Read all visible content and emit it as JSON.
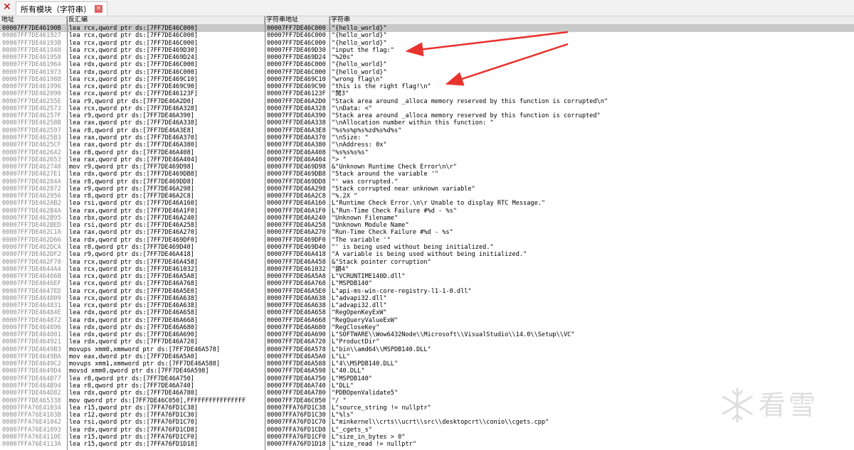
{
  "tab": {
    "title": "所有模块（字符串）"
  },
  "columns": {
    "addr": "地址",
    "disasm": "反汇编",
    "str_addr": "字符串地址",
    "string": "字符串"
  },
  "watermark": {
    "text": "看雪"
  },
  "colors": {
    "arrow": "#e8322d",
    "selected_row": "#c8c8c8",
    "address_text": "#8a8a8a"
  },
  "rows": [
    {
      "addr": "00007FF7DE46190B",
      "dis": "lea rcx,qword ptr ds:[7FF7DE46C000]",
      "saddr": "00007FF7DE46C000",
      "str": "\"{hello_world}\""
    },
    {
      "addr": "00007FF7DE461927",
      "dis": "lea rcx,qword ptr ds:[7FF7DE46C000]",
      "saddr": "00007FF7DE46C000",
      "str": "\"{hello_world}\""
    },
    {
      "addr": "00007FF7DE46193B",
      "dis": "lea rcx,qword ptr ds:[7FF7DE46C000]",
      "saddr": "00007FF7DE46C000",
      "str": "\"{hello_world}\""
    },
    {
      "addr": "00007FF7DE461948",
      "dis": "lea rcx,qword ptr ds:[7FF7DE469D30]",
      "saddr": "00007FF7DE469D30",
      "str": "\"input the flag:\""
    },
    {
      "addr": "00007FF7DE461958",
      "dis": "lea rcx,qword ptr ds:[7FF7DE469D24]",
      "saddr": "00007FF7DE469D24",
      "str": "\"%20s\""
    },
    {
      "addr": "00007FF7DE461964",
      "dis": "lea rdx,qword ptr ds:[7FF7DE46C000]",
      "saddr": "00007FF7DE46C000",
      "str": "\"{hello_world}\""
    },
    {
      "addr": "00007FF7DE461973",
      "dis": "lea rdx,qword ptr ds:[7FF7DE46C000]",
      "saddr": "00007FF7DE46C000",
      "str": "\"{hello_world}\""
    },
    {
      "addr": "00007FF7DE461988",
      "dis": "lea rcx,qword ptr ds:[7FF7DE469C10]",
      "saddr": "00007FF7DE469C10",
      "str": "\"wrong flag\\n\""
    },
    {
      "addr": "00007FF7DE461996",
      "dis": "lea rcx,qword ptr ds:[7FF7DE469C90]",
      "saddr": "00007FF7DE469C90",
      "str": "\"this is the right flag!\\n\""
    },
    {
      "addr": "00007FF7DE462090",
      "dis": "lea rcx,qword ptr ds:[7FF7DE46123F]",
      "saddr": "00007FF7DE46123F",
      "str": "\"閒3\""
    },
    {
      "addr": "00007FF7DE46255E",
      "dis": "lea r9,qword ptr ds:[7FF7DE46A2D0]",
      "saddr": "00007FF7DE46A2D0",
      "str": "\"Stack area around _alloca memory reserved by this function is corrupted\\n\""
    },
    {
      "addr": "00007FF7DE462573",
      "dis": "lea rcx,qword ptr ds:[7FF7DE46A328]",
      "saddr": "00007FF7DE46A328",
      "str": "\"\\nData: <\""
    },
    {
      "addr": "00007FF7DE46257F",
      "dis": "lea r9,qword ptr ds:[7FF7DE46A390]",
      "saddr": "00007FF7DE46A390",
      "str": "\"Stack area around _alloca memory reserved by this function is corrupted\""
    },
    {
      "addr": "00007FF7DE46258B",
      "dis": "lea rax,qword ptr ds:[7FF7DE46A338]",
      "saddr": "00007FF7DE46A338",
      "str": "\"\\nAllocation number within this function: \""
    },
    {
      "addr": "00007FF7DE462597",
      "dis": "lea r8,qword ptr ds:[7FF7DE46A3E8]",
      "saddr": "00007FF7DE46A3E8",
      "str": "\"%s%s%p%s%zd%s%d%s\""
    },
    {
      "addr": "00007FF7DE4625B3",
      "dis": "lea rax,qword ptr ds:[7FF7DE46A370]",
      "saddr": "00007FF7DE46A370",
      "str": "\"\\nSize: \""
    },
    {
      "addr": "00007FF7DE4625CF",
      "dis": "lea rax,qword ptr ds:[7FF7DE46A380]",
      "saddr": "00007FF7DE46A380",
      "str": "\"\\nAddress: 0x\""
    },
    {
      "addr": "00007FF7DE462642",
      "dis": "lea r8,qword ptr ds:[7FF7DE46A408]",
      "saddr": "00007FF7DE46A408",
      "str": "\"%s%s%s%s\""
    },
    {
      "addr": "00007FF7DE462653",
      "dis": "lea rax,qword ptr ds:[7FF7DE46A404]",
      "saddr": "00007FF7DE46A404",
      "str": "\"> \""
    },
    {
      "addr": "00007FF7DE462740",
      "dis": "mov r9,qword ptr ds:[7FF7DE469D98]",
      "saddr": "00007FF7DE469D98",
      "str": "&\"Unknown Runtime Check Error\\n\\r\""
    },
    {
      "addr": "00007FF7DE4627E1",
      "dis": "lea rdx,qword ptr ds:[7FF7DE469DB8]",
      "saddr": "00007FF7DE469DB8",
      "str": "\"Stack around the variable '\""
    },
    {
      "addr": "00007FF7DE46284A",
      "dis": "lea r8,qword ptr ds:[7FF7DE469DD8]",
      "saddr": "00007FF7DE469DD8",
      "str": "\"' was corrupted.\""
    },
    {
      "addr": "00007FF7DE462872",
      "dis": "lea r9,qword ptr ds:[7FF7DE46A298]",
      "saddr": "00007FF7DE46A298",
      "str": "\"Stack corrupted near unknown variable\""
    },
    {
      "addr": "00007FF7DE462956",
      "dis": "lea r8,qword ptr ds:[7FF7DE46A2C8]",
      "saddr": "00007FF7DE46A2C8",
      "str": "\"%.2X \""
    },
    {
      "addr": "00007FF7DE462AB2",
      "dis": "lea rsi,qword ptr ds:[7FF7DE46A160]",
      "saddr": "00007FF7DE46A160",
      "str": "L\"Runtime Check Error.\\n\\r Unable to display RTC Message.\""
    },
    {
      "addr": "00007FF7DE462B4A",
      "dis": "lea rax,qword ptr ds:[7FF7DE46A1F0]",
      "saddr": "00007FF7DE46A1F0",
      "str": "L\"Run-Time Check Failure #%d - %s\""
    },
    {
      "addr": "00007FF7DE462B95",
      "dis": "lea rbx,qword ptr ds:[7FF7DE46A240]",
      "saddr": "00007FF7DE46A240",
      "str": "\"Unknown Filename\""
    },
    {
      "addr": "00007FF7DE462BED",
      "dis": "lea rsi,qword ptr ds:[7FF7DE46A258]",
      "saddr": "00007FF7DE46A258",
      "str": "\"Unknown Module Name\""
    },
    {
      "addr": "00007FF7DE462C1A",
      "dis": "lea rax,qword ptr ds:[7FF7DE46A270]",
      "saddr": "00007FF7DE46A270",
      "str": "\"Run-Time Check Failure #%d - %s\""
    },
    {
      "addr": "00007FF7DE462D66",
      "dis": "lea rdx,qword ptr ds:[7FF7DE469DF0]",
      "saddr": "00007FF7DE469DF0",
      "str": "\"The variable '\""
    },
    {
      "addr": "00007FF7DE462DCA",
      "dis": "lea r8,qword ptr ds:[7FF7DE469D40]",
      "saddr": "00007FF7DE469D40",
      "str": "\"' is being used without being initialized.\""
    },
    {
      "addr": "00007FF7DE462DF2",
      "dis": "lea r9,qword ptr ds:[7FF7DE46A418]",
      "saddr": "00007FF7DE46A418",
      "str": "\"A variable is being used without being initialized.\""
    },
    {
      "addr": "00007FF7DE462F78",
      "dis": "lea rcx,qword ptr ds:[7FF7DE46A458]",
      "saddr": "00007FF7DE46A458",
      "str": "&\"Stack pointer corruption\""
    },
    {
      "addr": "00007FF7DE4644A4",
      "dis": "lea rcx,qword ptr ds:[7FF7DE461032]",
      "saddr": "00007FF7DE461032",
      "str": "\"韻4\""
    },
    {
      "addr": "00007FF7DE46466B",
      "dis": "lea rcx,qword ptr ds:[7FF7DE46A5A8]",
      "saddr": "00007FF7DE46A5A8",
      "str": "L\"VCRUNTIME140D.dll\""
    },
    {
      "addr": "00007FF7DE4646EF",
      "dis": "lea rcx,qword ptr ds:[7FF7DE46A768]",
      "saddr": "00007FF7DE46A768",
      "str": "L\"MSPDB140\""
    },
    {
      "addr": "00007FF7DE4647ED",
      "dis": "lea rcx,qword ptr ds:[7FF7DE46A5E0]",
      "saddr": "00007FF7DE46A5E0",
      "str": "L\"api-ms-win-core-registry-l1-1-0.dll\""
    },
    {
      "addr": "00007FF7DE464809",
      "dis": "lea rcx,qword ptr ds:[7FF7DE46A638]",
      "saddr": "00007FF7DE46A638",
      "str": "L\"advapi32.dll\""
    },
    {
      "addr": "00007FF7DE464831",
      "dis": "lea rcx,qword ptr ds:[7FF7DE46A638]",
      "saddr": "00007FF7DE46A638",
      "str": "L\"advapi32.dll\""
    },
    {
      "addr": "00007FF7DE46484E",
      "dis": "lea rdx,qword ptr ds:[7FF7DE46A658]",
      "saddr": "00007FF7DE46A658",
      "str": "\"RegOpenKeyExW\""
    },
    {
      "addr": "00007FF7DE464872",
      "dis": "lea rdx,qword ptr ds:[7FF7DE46A668]",
      "saddr": "00007FF7DE46A668",
      "str": "\"RegQueryValueExW\""
    },
    {
      "addr": "00007FF7DE464896",
      "dis": "lea rdx,qword ptr ds:[7FF7DE46A680]",
      "saddr": "00007FF7DE46A680",
      "str": "\"RegCloseKey\""
    },
    {
      "addr": "00007FF7DE464801",
      "dis": "lea rdx,qword ptr ds:[7FF7DE46A690]",
      "saddr": "00007FF7DE46A690",
      "str": "L\"SOFTWARE\\\\Wow6432Node\\\\Microsoft\\\\VisualStudio\\\\14.0\\\\Setup\\\\VC\""
    },
    {
      "addr": "00007FF7DE464921",
      "dis": "lea rdx,qword ptr ds:[7FF7DE46A720]",
      "saddr": "00007FF7DE46A720",
      "str": "L\"ProductDir\""
    },
    {
      "addr": "00007FF7DE4649B3",
      "dis": "movups xmm0,xmmword ptr ds:[7FF7DE46A578]",
      "saddr": "00007FF7DE46A578",
      "str": "L\"bin\\\\amd64\\\\MSPDB140.DLL\""
    },
    {
      "addr": "00007FF7DE4649BA",
      "dis": "mov eax,dword ptr ds:[7FF7DE46A5A0]",
      "saddr": "00007FF7DE46A5A0",
      "str": "L\"LL\""
    },
    {
      "addr": "00007FF7DE4649C2",
      "dis": "movups xmm1,xmmword ptr ds:[7FF7DE46A588]",
      "saddr": "00007FF7DE46A588",
      "str": "L\"4\\\\MSPDB140.DLL\""
    },
    {
      "addr": "00007FF7DE4649D4",
      "dis": "movsd xmm0,qword ptr ds:[7FF7DE46A598]",
      "saddr": "00007FF7DE46A598",
      "str": "L\"40.DLL\""
    },
    {
      "addr": "00007FF7DE464B77",
      "dis": "lea r8,qword ptr ds:[7FF7DE46A750]",
      "saddr": "00007FF7DE46A750",
      "str": "L\"MSPDB140\""
    },
    {
      "addr": "00007FF7DE464B94",
      "dis": "lea r8,qword ptr ds:[7FF7DE46A740]",
      "saddr": "00007FF7DE46A740",
      "str": "L\"DLL\""
    },
    {
      "addr": "00007FF7DE464D82",
      "dis": "lea rdx,qword ptr ds:[7FF7DE46A780]",
      "saddr": "00007FF7DE46A780",
      "str": "\"PDBOpenValidate5\""
    },
    {
      "addr": "00007FF7DE465338",
      "dis": "mov qword ptr ds:[7FF7DE46C050],FFFFFFFFFFFFFFFF",
      "saddr": "00007FF7DE46C050",
      "str": "\"/ \""
    },
    {
      "addr": "00007FFA76E41034",
      "dis": "lea r15,qword ptr ds:[7FFA76FD1C38]",
      "saddr": "00007FFA76FD1C38",
      "str": "L\"source_string != nullptr\""
    },
    {
      "addr": "00007FFA76E4103B",
      "dis": "lea r12,qword ptr ds:[7FFA76FD1C30]",
      "saddr": "00007FFA76FD1C30",
      "str": "L\"%ls\""
    },
    {
      "addr": "00007FFA76E41042",
      "dis": "lea rsi,qword ptr ds:[7FFA76FD1C70]",
      "saddr": "00007FFA76FD1C70",
      "str": "L\"minkernel\\\\crts\\\\ucrt\\\\src\\\\desktopcrt\\\\conio\\\\cgets.cpp\""
    },
    {
      "addr": "00007FFA76E41093",
      "dis": "lea rdx,qword ptr ds:[7FFA76FD1CD8]",
      "saddr": "00007FFA76FD1CD8",
      "str": "L\"_cgets_s\""
    },
    {
      "addr": "00007FFA76E4110E",
      "dis": "lea r15,qword ptr ds:[7FFA76FD1CF0]",
      "saddr": "00007FFA76FD1CF0",
      "str": "L\"size_in_bytes > 0\""
    },
    {
      "addr": "00007FFA76E4113A",
      "dis": "lea r15,qword ptr ds:[7FFA76FD1D18]",
      "saddr": "00007FFA76FD1D18",
      "str": "L\"size_read != nullptr\""
    }
  ]
}
